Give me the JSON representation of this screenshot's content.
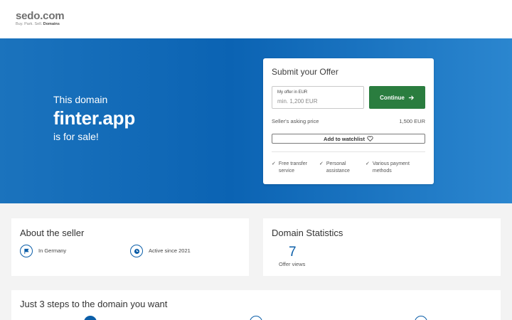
{
  "header": {
    "logo": "sedo.com",
    "tagline_plain": "Buy.  Park.  Sell. ",
    "tagline_bold": "Domains"
  },
  "hero": {
    "intro": "This domain",
    "domain": "finter.app",
    "outro": "is for sale!"
  },
  "offer": {
    "title": "Submit your Offer",
    "input_label": "My offer in EUR",
    "input_placeholder": "min. 1,200 EUR",
    "continue_label": "Continue",
    "asking_label": "Seller's asking price",
    "asking_price": "1,500 EUR",
    "watchlist_label": "Add to watchlist",
    "features": [
      {
        "line1": "Free transfer",
        "line2": "service"
      },
      {
        "line1": "Personal",
        "line2": "assistance"
      },
      {
        "line1": "Various payment",
        "line2": "methods"
      }
    ]
  },
  "seller": {
    "title": "About the seller",
    "location": "In Germany",
    "active": "Active since 2021"
  },
  "stats": {
    "title": "Domain Statistics",
    "offer_views": "7",
    "offer_views_label": "Offer views"
  },
  "steps": {
    "title": "Just 3 steps to the domain you want"
  },
  "colors": {
    "brand_blue": "#0b5ea8",
    "continue_green": "#2a7d3f"
  }
}
